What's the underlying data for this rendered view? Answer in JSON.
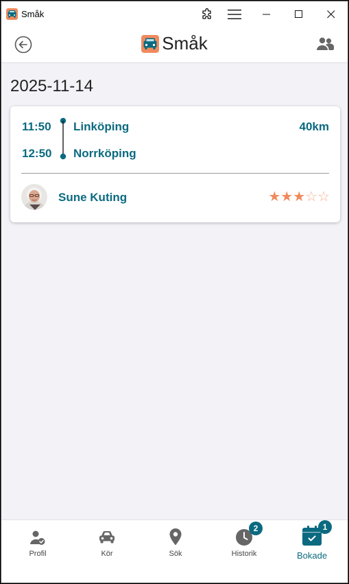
{
  "window": {
    "title": "Småk"
  },
  "header": {
    "brand": "Småk",
    "back_icon": "arrow-left-circle-icon",
    "people_icon": "users-icon"
  },
  "content": {
    "date": "2025-11-14",
    "trip": {
      "departure_time": "11:50",
      "arrival_time": "12:50",
      "from": "Linköping",
      "to": "Norrköping",
      "distance": "40km",
      "driver": "Sune Kuting",
      "rating": 3,
      "rating_max": 5
    }
  },
  "nav": {
    "items": [
      {
        "label": "Profil",
        "icon": "user-check-icon"
      },
      {
        "label": "Kör",
        "icon": "car-icon"
      },
      {
        "label": "Sök",
        "icon": "location-pin-icon"
      },
      {
        "label": "Historik",
        "icon": "clock-icon",
        "badge": "2"
      },
      {
        "label": "Bokade",
        "icon": "calendar-check-icon",
        "badge": "1",
        "active": true
      }
    ]
  },
  "colors": {
    "accent": "#0b6a80",
    "star": "#f08a5d",
    "background": "#f2f2f7"
  }
}
